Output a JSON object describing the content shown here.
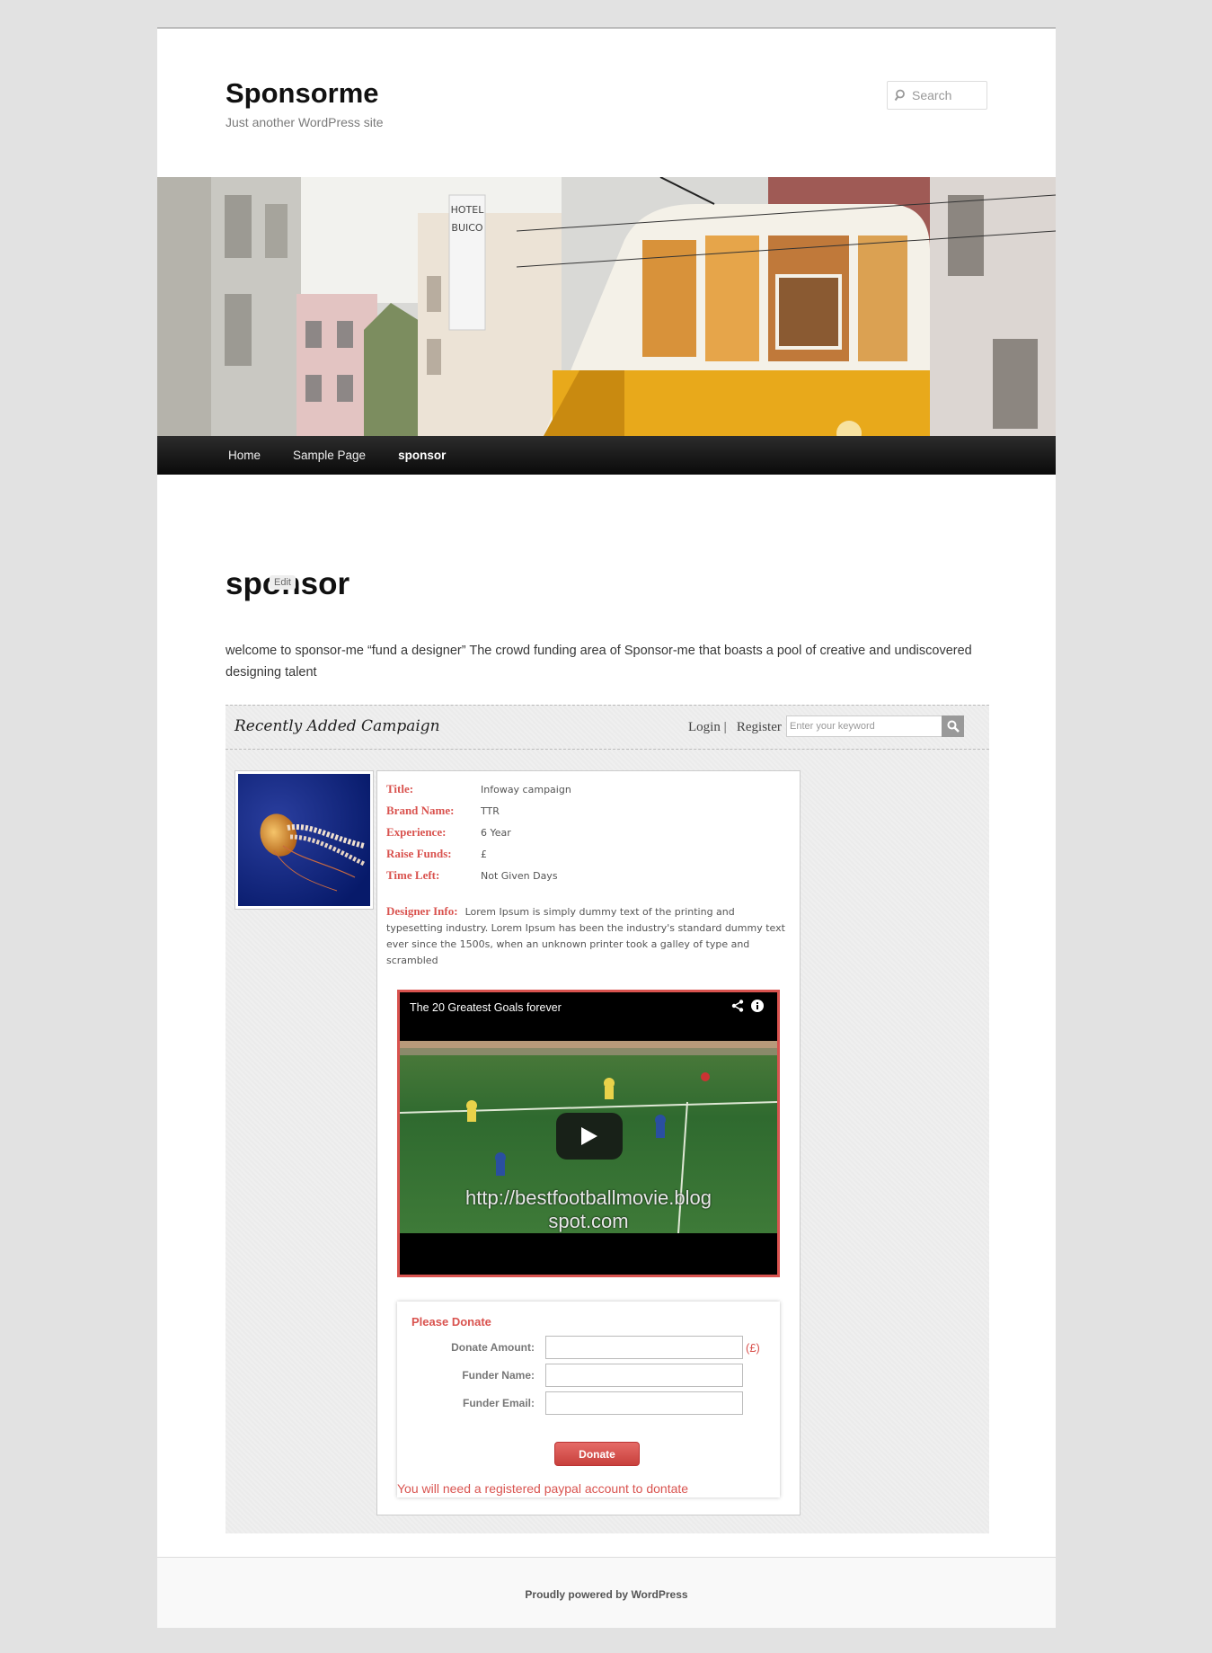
{
  "site": {
    "title": "Sponsorme",
    "description": "Just another WordPress site"
  },
  "search": {
    "placeholder": "Search"
  },
  "nav": {
    "items": [
      {
        "label": "Home"
      },
      {
        "label": "Sample Page"
      },
      {
        "label": "sponsor",
        "current": true
      }
    ]
  },
  "page": {
    "title": "sponsor",
    "edit_label": "Edit",
    "intro": "welcome to sponsor-me “fund a designer” The crowd funding area of Sponsor-me that boasts a pool of creative and undiscovered designing talent"
  },
  "campaign_section": {
    "heading": "Recently Added Campaign",
    "login_label": "Login",
    "separator": "|",
    "register_label": "Register",
    "keyword_placeholder": "Enter your keyword"
  },
  "campaign": {
    "fields": [
      {
        "label": "Title:",
        "value": "Infoway campaign"
      },
      {
        "label": "Brand Name:",
        "value": "TTR"
      },
      {
        "label": "Experience:",
        "value": "6 Year"
      },
      {
        "label": "Raise Funds:",
        "value": "£"
      },
      {
        "label": "Time Left:",
        "value": "Not Given Days"
      }
    ],
    "designer_label": "Designer Info:",
    "designer_info": "Lorem Ipsum is simply dummy text of the printing and typesetting industry. Lorem Ipsum has been the industry's standard dummy text ever since the 1500s, when an unknown printer took a galley of type and scrambled"
  },
  "video": {
    "title": "The 20 Greatest Goals forever",
    "overlay_line1": "http://bestfootballmovie.blog",
    "overlay_line2": "spot.com"
  },
  "donate": {
    "title": "Please Donate",
    "amount_label": "Donate Amount:",
    "currency": "(£)",
    "name_label": "Funder Name:",
    "email_label": "Funder Email:",
    "button_label": "Donate",
    "note": "You will need a registered paypal account to dontate"
  },
  "footer": {
    "text": "Proudly powered by WordPress"
  },
  "colors": {
    "accent_red": "#d9534f",
    "nav_bg": "#1a1a1a",
    "page_bg": "#e2e2e2",
    "tram_yellow": "#e8a91b"
  }
}
